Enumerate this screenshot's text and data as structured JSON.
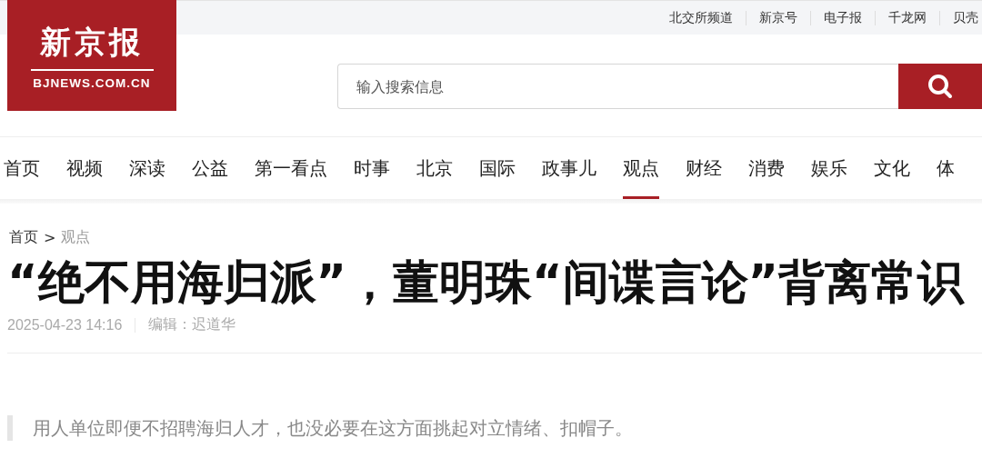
{
  "top_links": [
    "北交所频道",
    "新京号",
    "电子报",
    "千龙网",
    "贝壳"
  ],
  "logo": {
    "name": "新京报",
    "domain": "BJNEWS.COM.CN"
  },
  "search": {
    "placeholder": "输入搜索信息"
  },
  "nav": [
    {
      "label": "首页",
      "selected": false
    },
    {
      "label": "视频",
      "selected": false
    },
    {
      "label": "深读",
      "selected": false
    },
    {
      "label": "公益",
      "selected": false
    },
    {
      "label": "第一看点",
      "selected": false
    },
    {
      "label": "时事",
      "selected": false
    },
    {
      "label": "北京",
      "selected": false
    },
    {
      "label": "国际",
      "selected": false
    },
    {
      "label": "政事儿",
      "selected": false
    },
    {
      "label": "观点",
      "selected": true
    },
    {
      "label": "财经",
      "selected": false
    },
    {
      "label": "消费",
      "selected": false
    },
    {
      "label": "娱乐",
      "selected": false
    },
    {
      "label": "文化",
      "selected": false
    },
    {
      "label": "体",
      "selected": false
    }
  ],
  "breadcrumb": {
    "items": [
      "首页",
      "观点"
    ],
    "separator": ">"
  },
  "article": {
    "title": "“绝不用海归派”，董明珠“间谍言论”背离常识",
    "date": "2025-04-23 14:16",
    "editor": "编辑：迟道华",
    "lede": "用人单位即便不招聘海归人才，也没必要在这方面挑起对立情绪、扣帽子。"
  }
}
